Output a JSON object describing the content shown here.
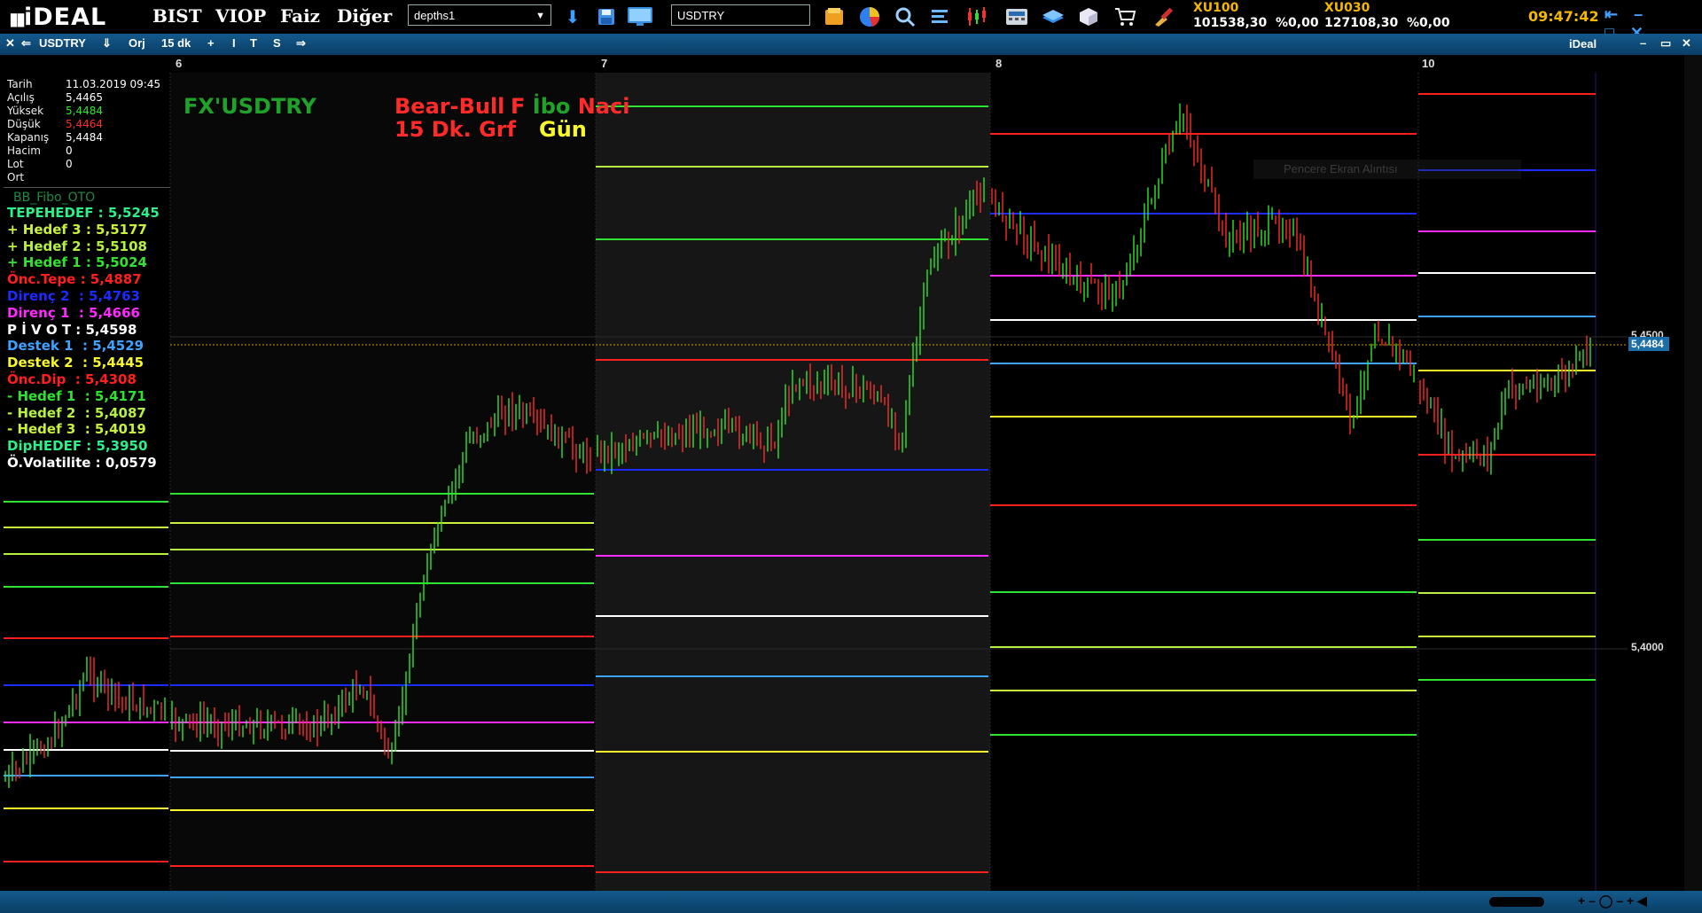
{
  "app": {
    "logo": "iDEAL",
    "menu": [
      "BIST",
      "VIOP",
      "Faiz",
      "Diğer"
    ],
    "layout_select": "depths1",
    "symbol_input": "USDTRY",
    "tickers": [
      {
        "name": "XU100",
        "value": "101538,30",
        "change": "%0,00"
      },
      {
        "name": "XU030",
        "value": "127108,30",
        "change": "%0,00"
      }
    ],
    "clock": "09:47:42",
    "toolbar_icons": [
      "download-icon",
      "save-icon",
      "monitor-icon",
      "folder-icon",
      "pie-chart-icon",
      "search-icon",
      "list-icon",
      "candlestick-icon",
      "calculator-icon",
      "stack-icon",
      "cube-icon",
      "cart-icon",
      "brush-icon"
    ]
  },
  "chart_window": {
    "symbol": "USDTRY",
    "orj_label": "Orj",
    "period": "15 dk",
    "toolbar_buttons": [
      "+",
      "I",
      "T",
      "S"
    ],
    "title_right": "iDeal",
    "tooltip": "Pencere Ekran Alıntısı"
  },
  "date_labels": [
    "6",
    "7",
    "8",
    "10"
  ],
  "info_panel": [
    {
      "label": "Tarih",
      "value": "11.03.2019 09:45",
      "color": "#ffffff"
    },
    {
      "label": "Açılış",
      "value": "5,4465",
      "color": "#ffffff"
    },
    {
      "label": "Yüksek",
      "value": "5,4484",
      "color": "#2ee82e"
    },
    {
      "label": "Düşük",
      "value": "5,4464",
      "color": "#ff2a2a"
    },
    {
      "label": "Kapanış",
      "value": "5,4484",
      "color": "#ffffff"
    },
    {
      "label": "Hacim",
      "value": "0",
      "color": "#ffffff"
    },
    {
      "label": "Lot",
      "value": "0",
      "color": "#ffffff"
    },
    {
      "label": "Ort",
      "value": "",
      "color": "#ffffff"
    }
  ],
  "fibo_panel": {
    "title": "BB_Fibo_OTO",
    "levels": [
      {
        "label": "TEPEHEDEF :",
        "value": "5,5245",
        "color": "#2df08a"
      },
      {
        "label": "+ Hedef 3 :",
        "value": "5,5177",
        "color": "#c8f03c"
      },
      {
        "label": "+ Hedef 2 :",
        "value": "5,5108",
        "color": "#b6f040"
      },
      {
        "label": "+ Hedef 1 :",
        "value": "5,5024",
        "color": "#31e331"
      },
      {
        "label": "Önc.Tepe :",
        "value": "5,4887",
        "color": "#ff1f1f"
      },
      {
        "label": "Direnç 2  :",
        "value": "5,4763",
        "color": "#1c2cff"
      },
      {
        "label": "Direnç 1  :",
        "value": "5,4666",
        "color": "#ff2aff"
      },
      {
        "label": "P İ V O T :",
        "value": "5,4598",
        "color": "#ffffff"
      },
      {
        "label": "Destek 1  :",
        "value": "5,4529",
        "color": "#3fa2ff"
      },
      {
        "label": "Destek 2  :",
        "value": "5,4445",
        "color": "#f7f72c"
      },
      {
        "label": "Önc.Dip  :",
        "value": "5,4308",
        "color": "#ff1f1f"
      },
      {
        "label": "- Hedef 1  :",
        "value": "5,4171",
        "color": "#31e331"
      },
      {
        "label": "- Hedef 2  :",
        "value": "5,4087",
        "color": "#b6f040"
      },
      {
        "label": "- Hedef 3  :",
        "value": "5,4019",
        "color": "#c8f03c"
      },
      {
        "label": "DipHEDEF :",
        "value": "5,3950",
        "color": "#2df08a"
      },
      {
        "label": "Ö.Volatilite :",
        "value": "0,0579",
        "color": "#ffffff"
      }
    ]
  },
  "chart_titles": {
    "symbol": "FX'USDTRY",
    "bear_bull": "Bear-Bull",
    "fibo_f": "F",
    "fibo_ibo": "İbo",
    "fibo_naci": "Naci",
    "timeframe": "15 Dk. Grf",
    "day": "Gün"
  },
  "price_axis": {
    "labels": [
      "5,4500",
      "5,4000"
    ],
    "last_price": "5,4484"
  },
  "chart_data": {
    "type": "candlestick",
    "symbol": "USDTRY",
    "interval": "15 dk",
    "x_labels": [
      "6",
      "7",
      "8",
      "10"
    ],
    "y_ticks": [
      "5,4500",
      "5,4000"
    ],
    "last_price": 5.4484,
    "daily_levels_order": [
      "TEPEHEDEF",
      "+Hedef 3",
      "+Hedef 2",
      "+Hedef 1",
      "Önc.Tepe",
      "Direnç 2",
      "Direnç 1",
      "PİVOT",
      "Destek 1",
      "Destek 2",
      "Önc.Dip",
      "-Hedef 1",
      "-Hedef 2",
      "-Hedef 3"
    ],
    "level_colors": [
      "#31e331",
      "#c8f03c",
      "#b6f040",
      "#31e331",
      "#ff1f1f",
      "#1c2cff",
      "#ff2aff",
      "#ffffff",
      "#3fa2ff",
      "#f7f72c",
      "#ff1f1f",
      "#31e331",
      "#b6f040",
      "#c8f03c"
    ]
  }
}
